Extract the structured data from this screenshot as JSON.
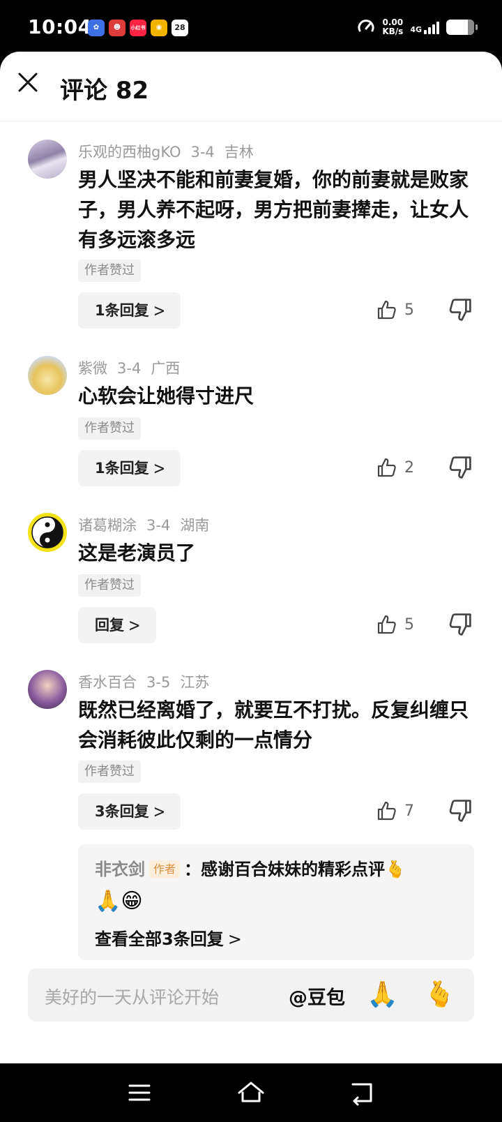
{
  "status_bar": {
    "time": "10:04",
    "apps": [
      {
        "icon": "baidu-app-icon",
        "label": "",
        "color": "#3d6fe6"
      },
      {
        "icon": "mascot-app-icon",
        "label": "",
        "color": "#e03b3b"
      },
      {
        "icon": "xiaohongshu-app-icon",
        "label": "小红书",
        "color": "#ff2442"
      },
      {
        "icon": "yellow-app-icon",
        "label": "",
        "color": "#f2b200"
      },
      {
        "icon": "calendar-app-icon",
        "label": "28",
        "color": "#ffffff"
      }
    ],
    "net_speed_value": "0.00",
    "net_speed_unit": "KB/s",
    "network": "4G",
    "battery_level": 0.78
  },
  "header": {
    "title": "评论 82"
  },
  "comments": [
    {
      "user": "乐观的西柚gKO",
      "date": "3-4",
      "location": "吉林",
      "text": "男人坚决不能和前妻复婚，你的前妻就是败家子，男人养不起呀，男方把前妻撵走，让女人有多远滚多远",
      "tag": "作者赞过",
      "reply_label": "1条回复",
      "likes": "5"
    },
    {
      "user": "紫微",
      "date": "3-4",
      "location": "广西",
      "text": "心软会让她得寸进尺",
      "tag": "作者赞过",
      "reply_label": "1条回复",
      "likes": "2"
    },
    {
      "user": "诸葛糊涂",
      "date": "3-4",
      "location": "湖南",
      "text": "这是老演员了",
      "tag": "作者赞过",
      "reply_label": "回复",
      "likes": "5"
    },
    {
      "user": "香水百合",
      "date": "3-5",
      "location": "江苏",
      "text": "既然已经离婚了，就要互不打扰。反复纠缠只会消耗彼此仅剩的一点情分",
      "tag": "作者赞过",
      "reply_label": "3条回复",
      "likes": "7"
    }
  ],
  "sub_reply": {
    "author": "非衣剑",
    "badge": "作者",
    "text": "：感谢百合妹妹的精彩点评",
    "emoji_heart_hand": "🫰",
    "emojis": "🙏😁",
    "view_all": "查看全部3条回复"
  },
  "input_bar": {
    "placeholder": "美好的一天从评论开始",
    "at_mention": "@豆包",
    "emoji_1": "🙏",
    "emoji_2": "🫰"
  },
  "nav": {
    "icons": [
      "menu-icon",
      "home-icon",
      "back-icon"
    ]
  },
  "colors": {
    "background": "#ffffff",
    "meta_text": "#9a9a9a",
    "reply_bg": "#f3f3f3",
    "author_badge": "#d69040"
  }
}
